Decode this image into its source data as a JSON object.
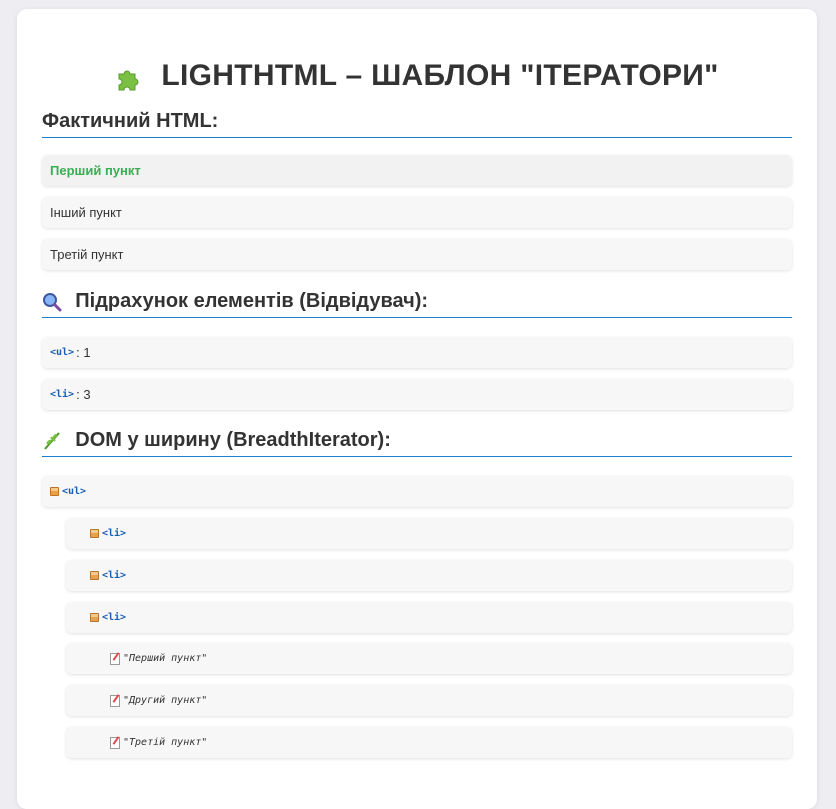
{
  "title": "LIGHTHTML – ШАБЛОН \"ІТЕРАТОРИ\"",
  "title_icon": "puzzle-piece-icon",
  "sections": {
    "html": {
      "label": "Фактичний HTML:"
    },
    "counter": {
      "label": "Підрахунок елементів (Відвідувач):",
      "icon": "magnifier-icon"
    },
    "bfs": {
      "label": "DOM у ширину (BreadthIterator):",
      "icon": "herb-icon"
    }
  },
  "html_items": [
    "Перший пункт",
    "Інший пункт",
    "Третій пункт"
  ],
  "counts": [
    {
      "tag": "<ul>",
      "count": ": 1"
    },
    {
      "tag": "<li>",
      "count": ": 3"
    }
  ],
  "bfs_nodes": [
    {
      "text": "<ul>",
      "kind": "element",
      "icon": "package-icon"
    },
    {
      "text": "<li>",
      "kind": "element",
      "icon": "package-icon"
    },
    {
      "text": "<li>",
      "kind": "element",
      "icon": "package-icon"
    },
    {
      "text": "<li>",
      "kind": "element",
      "icon": "package-icon"
    },
    {
      "text": "\"Перший пункт\"",
      "kind": "text",
      "icon": "memo-icon"
    },
    {
      "text": "\"Другий пункт\"",
      "kind": "text",
      "icon": "memo-icon"
    },
    {
      "text": "\"Третій пункт\"",
      "kind": "text",
      "icon": "memo-icon"
    }
  ],
  "colors": {
    "accent": "#1a7fd0",
    "highlight": "#3aae52",
    "background": "#eeeef2"
  }
}
